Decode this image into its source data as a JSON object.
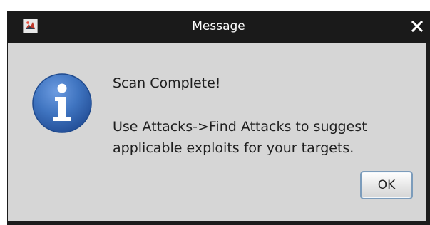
{
  "window": {
    "title": "Message",
    "app_icon": "java-app-icon",
    "close_icon": "close-icon"
  },
  "dialog": {
    "icon": "info-icon",
    "heading": "Scan Complete!",
    "body_line_1": "Use Attacks->Find Attacks to suggest",
    "body_line_2": "applicable exploits for your targets.",
    "ok_label": "OK"
  },
  "colors": {
    "titlebar": "#1a1a1a",
    "content_bg": "#d6d6d6",
    "info_icon_blue": "#3f74c0",
    "button_border": "#7c9cbb"
  }
}
